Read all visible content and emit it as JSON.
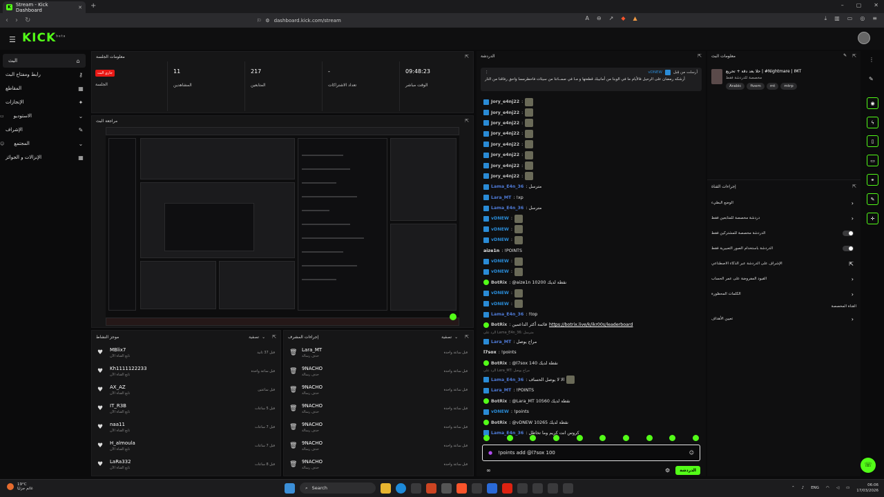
{
  "browser": {
    "tab_title": "Stream - Kick Dashboard",
    "url": "dashboard.kick.com/stream"
  },
  "kick": {
    "logo": "KICK",
    "logo_sup": "beta"
  },
  "sidebar": {
    "items": [
      {
        "label": "البث",
        "icon": "home-icon"
      },
      {
        "label": "رابط ومفتاح البث",
        "icon": "key-icon"
      },
      {
        "label": "المقاطع",
        "icon": "clip-icon"
      },
      {
        "label": "الإنجازات",
        "icon": "trophy-icon"
      },
      {
        "label": "الاستوديو",
        "icon": "chevron-down-icon"
      },
      {
        "label": "الإشراف",
        "icon": "wrench-icon"
      },
      {
        "label": "المجتمع",
        "icon": "chevron-down-icon"
      },
      {
        "label": "الإنزالات و الجوائز",
        "icon": "grid-icon"
      }
    ]
  },
  "session": {
    "title": "معلومات الجلسة",
    "live_badge": "جاري البث",
    "live_label": "الجلسة",
    "viewers_value": "11",
    "viewers_label": "المشاهدين",
    "followers_value": "217",
    "followers_label": "المتابعين",
    "subs_value": "-",
    "subs_label": "تعداد الاشتراكات",
    "uptime_value": "09:48:23",
    "uptime_label": "الوقت مباشر"
  },
  "preview": {
    "title": "مراجعة البث"
  },
  "activity": {
    "title": "موجز النشاط",
    "filter": "تصفية",
    "rows": [
      {
        "name": "MBlix7",
        "sub": "تابع القناة الآن",
        "time": "قبل 37 ثانية"
      },
      {
        "name": "Kh1111122233",
        "sub": "تابع القناة الآن",
        "time": "قبل ساعة واحدة"
      },
      {
        "name": "AX_AZ",
        "sub": "تابع القناة الآن",
        "time": "قبل ساعتين"
      },
      {
        "name": "IT_R3B",
        "sub": "تابع القناة الآن",
        "time": "قبل 5 ساعات"
      },
      {
        "name": "naa11",
        "sub": "تابع القناة الآن",
        "time": "قبل 7 ساعات"
      },
      {
        "name": "H_almoula",
        "sub": "تابع القناة الآن",
        "time": "قبل 7 ساعات"
      },
      {
        "name": "LaRa332",
        "sub": "تابع القناة الآن",
        "time": "قبل 8 ساعات"
      }
    ]
  },
  "modlog": {
    "title": "إجراءات المشرف",
    "filter": "تصفية",
    "rows": [
      {
        "name": "Lara_MT",
        "sub": "حذف رسالة",
        "time": "قبل ساعة واحدة"
      },
      {
        "name": "9NACHO",
        "sub": "حذف رسالة",
        "time": "قبل ساعة واحدة"
      },
      {
        "name": "9NACHO",
        "sub": "حذف رسالة",
        "time": "قبل ساعة واحدة"
      },
      {
        "name": "9NACHO",
        "sub": "حذف رسالة",
        "time": "قبل ساعة واحدة"
      },
      {
        "name": "9NACHO",
        "sub": "حذف رسالة",
        "time": "قبل ساعة واحدة"
      },
      {
        "name": "9NACHO",
        "sub": "حذف رسالة",
        "time": "قبل ساعة واحدة"
      },
      {
        "name": "9NACHO",
        "sub": "حذف رسالة",
        "time": "قبل ساعة واحدة"
      }
    ]
  },
  "chat": {
    "title": "الدردشة",
    "pinned_by_user": "vDNEW",
    "pinned_by_label": "أرسلت من قِبل",
    "pinned_text": "أرشكه رمضان على الرحيل فالأيام ما في الوبنا من أمانيبك قطعتها و مـا في صمــاتنا من سيئات فاحطرمسا واحق رفاقنا من النار",
    "messages": [
      {
        "user": "Jory_e4nj22",
        "color": "#c4c4c4",
        "badge": "sub",
        "text": ":",
        "emote": true
      },
      {
        "user": "Jory_e4nj22",
        "color": "#c4c4c4",
        "badge": "sub",
        "text": ":",
        "emote": true
      },
      {
        "user": "Jory_e4nj22",
        "color": "#c4c4c4",
        "badge": "sub",
        "text": ":",
        "emote": true
      },
      {
        "user": "Jory_e4nj22",
        "color": "#c4c4c4",
        "badge": "sub",
        "text": ":",
        "emote": true
      },
      {
        "user": "Jory_e4nj22",
        "color": "#c4c4c4",
        "badge": "sub",
        "text": ":",
        "emote": true
      },
      {
        "user": "Jory_e4nj22",
        "color": "#c4c4c4",
        "badge": "sub",
        "text": ":",
        "emote": true
      },
      {
        "user": "Jory_e4nj22",
        "color": "#c4c4c4",
        "badge": "sub",
        "text": ":",
        "emote": true
      },
      {
        "user": "Jory_e4nj22",
        "color": "#c4c4c4",
        "badge": "sub",
        "text": ":",
        "emote": true
      },
      {
        "user": "Lama_E4n_36",
        "color": "#4f7bd8",
        "badge": "sub",
        "text": ": مترسل"
      },
      {
        "user": "Lara_MT",
        "color": "#4f7bd8",
        "badge": "sub",
        "text": ": !xp"
      },
      {
        "user": "Lama_E4n_36",
        "color": "#4f7bd8",
        "badge": "sub",
        "text": ": مترسل"
      },
      {
        "user": "vDNEW",
        "color": "#2a8bd6",
        "badge": "sub",
        "text": ":",
        "emote": true
      },
      {
        "user": "vDNEW",
        "color": "#2a8bd6",
        "badge": "sub",
        "text": ":",
        "emote": true
      },
      {
        "user": "vDNEW",
        "color": "#2a8bd6",
        "badge": "sub",
        "text": ":",
        "emote": true
      },
      {
        "user": "aize1n",
        "color": "#e6e6e6",
        "badge": "none",
        "text": ": !POINTS"
      },
      {
        "user": "vDNEW",
        "color": "#2a8bd6",
        "badge": "sub",
        "text": ":",
        "emote": true
      },
      {
        "user": "vDNEW",
        "color": "#2a8bd6",
        "badge": "sub",
        "text": ":",
        "emote": true
      },
      {
        "user": "BotRix",
        "color": "#c4c4c4",
        "badge": "bot",
        "text": ": @aize1n 10200 نقطة لديك"
      },
      {
        "user": "vDNEW",
        "color": "#2a8bd6",
        "badge": "sub",
        "text": ":",
        "emote": true
      },
      {
        "user": "vDNEW",
        "color": "#2a8bd6",
        "badge": "sub",
        "text": ":",
        "emote": true
      },
      {
        "user": "Lama_E4n_36",
        "color": "#4f7bd8",
        "badge": "sub",
        "text": ": !top"
      },
      {
        "user": "BotRix",
        "color": "#c4c4c4",
        "badge": "bot",
        "text": ": قائمة أكثر الداعمين",
        "link": "https://botrix.live/k/ikr00s/leaderboard"
      }
    ],
    "reply1_text": "الرد على Lama_E4n_36: مترسل",
    "messages2": [
      {
        "user": "Lara_MT",
        "color": "#4f7bd8",
        "badge": "sub",
        "text": ": مراح يوصل"
      },
      {
        "user": "l7sox",
        "color": "#e6e6e6",
        "badge": "none",
        "text": ": !points"
      },
      {
        "user": "BotRix",
        "color": "#c4c4c4",
        "badge": "bot",
        "text": ": @l7sox 140 نقطة لديك"
      }
    ],
    "reply2_text": "الرد على Lara_MT: مراح يوصل",
    "messages3": [
      {
        "user": "Lama_E4n_36",
        "color": "#4f7bd8",
        "badge": "sub",
        "text": ": الا لا يوصل الحساف",
        "emote": true
      },
      {
        "user": "Lara_MT",
        "color": "#4f7bd8",
        "badge": "sub",
        "text": ": !POINTS"
      },
      {
        "user": "BotRix",
        "color": "#c4c4c4",
        "badge": "bot",
        "text": ": @Lara_MT 10560 نقطة لديك"
      },
      {
        "user": "vDNEW",
        "color": "#2a8bd6",
        "badge": "sub",
        "text": ": !points"
      },
      {
        "user": "BotRix",
        "color": "#c4c4c4",
        "badge": "bot",
        "text": ": @vDNEW 10265 نقطة لديك"
      },
      {
        "user": "Lama_E4n_36",
        "color": "#4f7bd8",
        "badge": "sub",
        "text": ": كروس انت كريم وما تخاطل"
      }
    ],
    "input_value": "!points add @l7sox 100",
    "send_label": "الدردشة"
  },
  "streaminfo": {
    "title": "معلومات البث",
    "stream_title": "حلا بعد دقة + تحريع | #Nightmare | IMT",
    "category": "مخصصة للدردشة فقط",
    "tags": [
      "Arabic",
      "fivem",
      "mt",
      "mtrp"
    ]
  },
  "channel_actions": {
    "title": "إجراءات القناة",
    "rows": [
      {
        "label": "الوضع البطيء",
        "ctrl": "chevron"
      },
      {
        "label": "دردشة مخصصة للمتابعين فقط",
        "ctrl": "chevron"
      },
      {
        "label": "الدردشة مخصصة للمشتركين فقط",
        "ctrl": "toggle"
      },
      {
        "label": "الدردشة باستخدام الصور التعبيرية فقط",
        "ctrl": "toggle"
      },
      {
        "label": "الإشراف على الدردشة عبر الذكاء الاصطناعي",
        "ctrl": "link"
      },
      {
        "label": "القيود المفروضة على عمر الحساب",
        "ctrl": "chevron"
      },
      {
        "label": "الكلمات المحظورة",
        "ctrl": "chevron"
      }
    ],
    "section_label": "القناة المخصصة",
    "goals_label": "تعيين الأهداف"
  },
  "taskbar": {
    "temp": "19°C",
    "weather_text": "غائم جزئيًا",
    "search": "Search",
    "lang": "ENG",
    "time": "06:06",
    "date": "17/03/2026"
  }
}
